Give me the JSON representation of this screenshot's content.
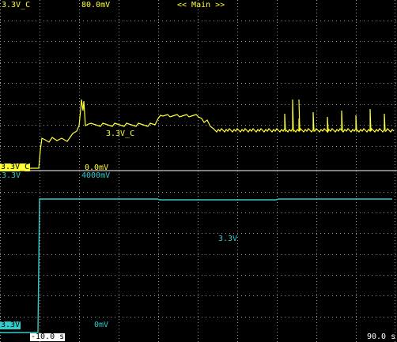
{
  "header": {
    "channel_label": "3.3V_C",
    "scale_label": "80.0mV",
    "view_label": "<< Main >>"
  },
  "top_pane": {
    "trace_label": "3.3V_C",
    "baseline_channel": "3.3V_C",
    "baseline_value": "0.0mV",
    "trace_color": "#ffff33"
  },
  "bottom_pane": {
    "channel_label": "3.3V",
    "scale_label": "4000mV",
    "trace_label": "3.3V",
    "baseline_channel": "3.3V",
    "baseline_value": "0mV",
    "trace_color": "#33cccc"
  },
  "time_axis": {
    "start": "-10.0 s",
    "end": "90.0 s"
  }
}
